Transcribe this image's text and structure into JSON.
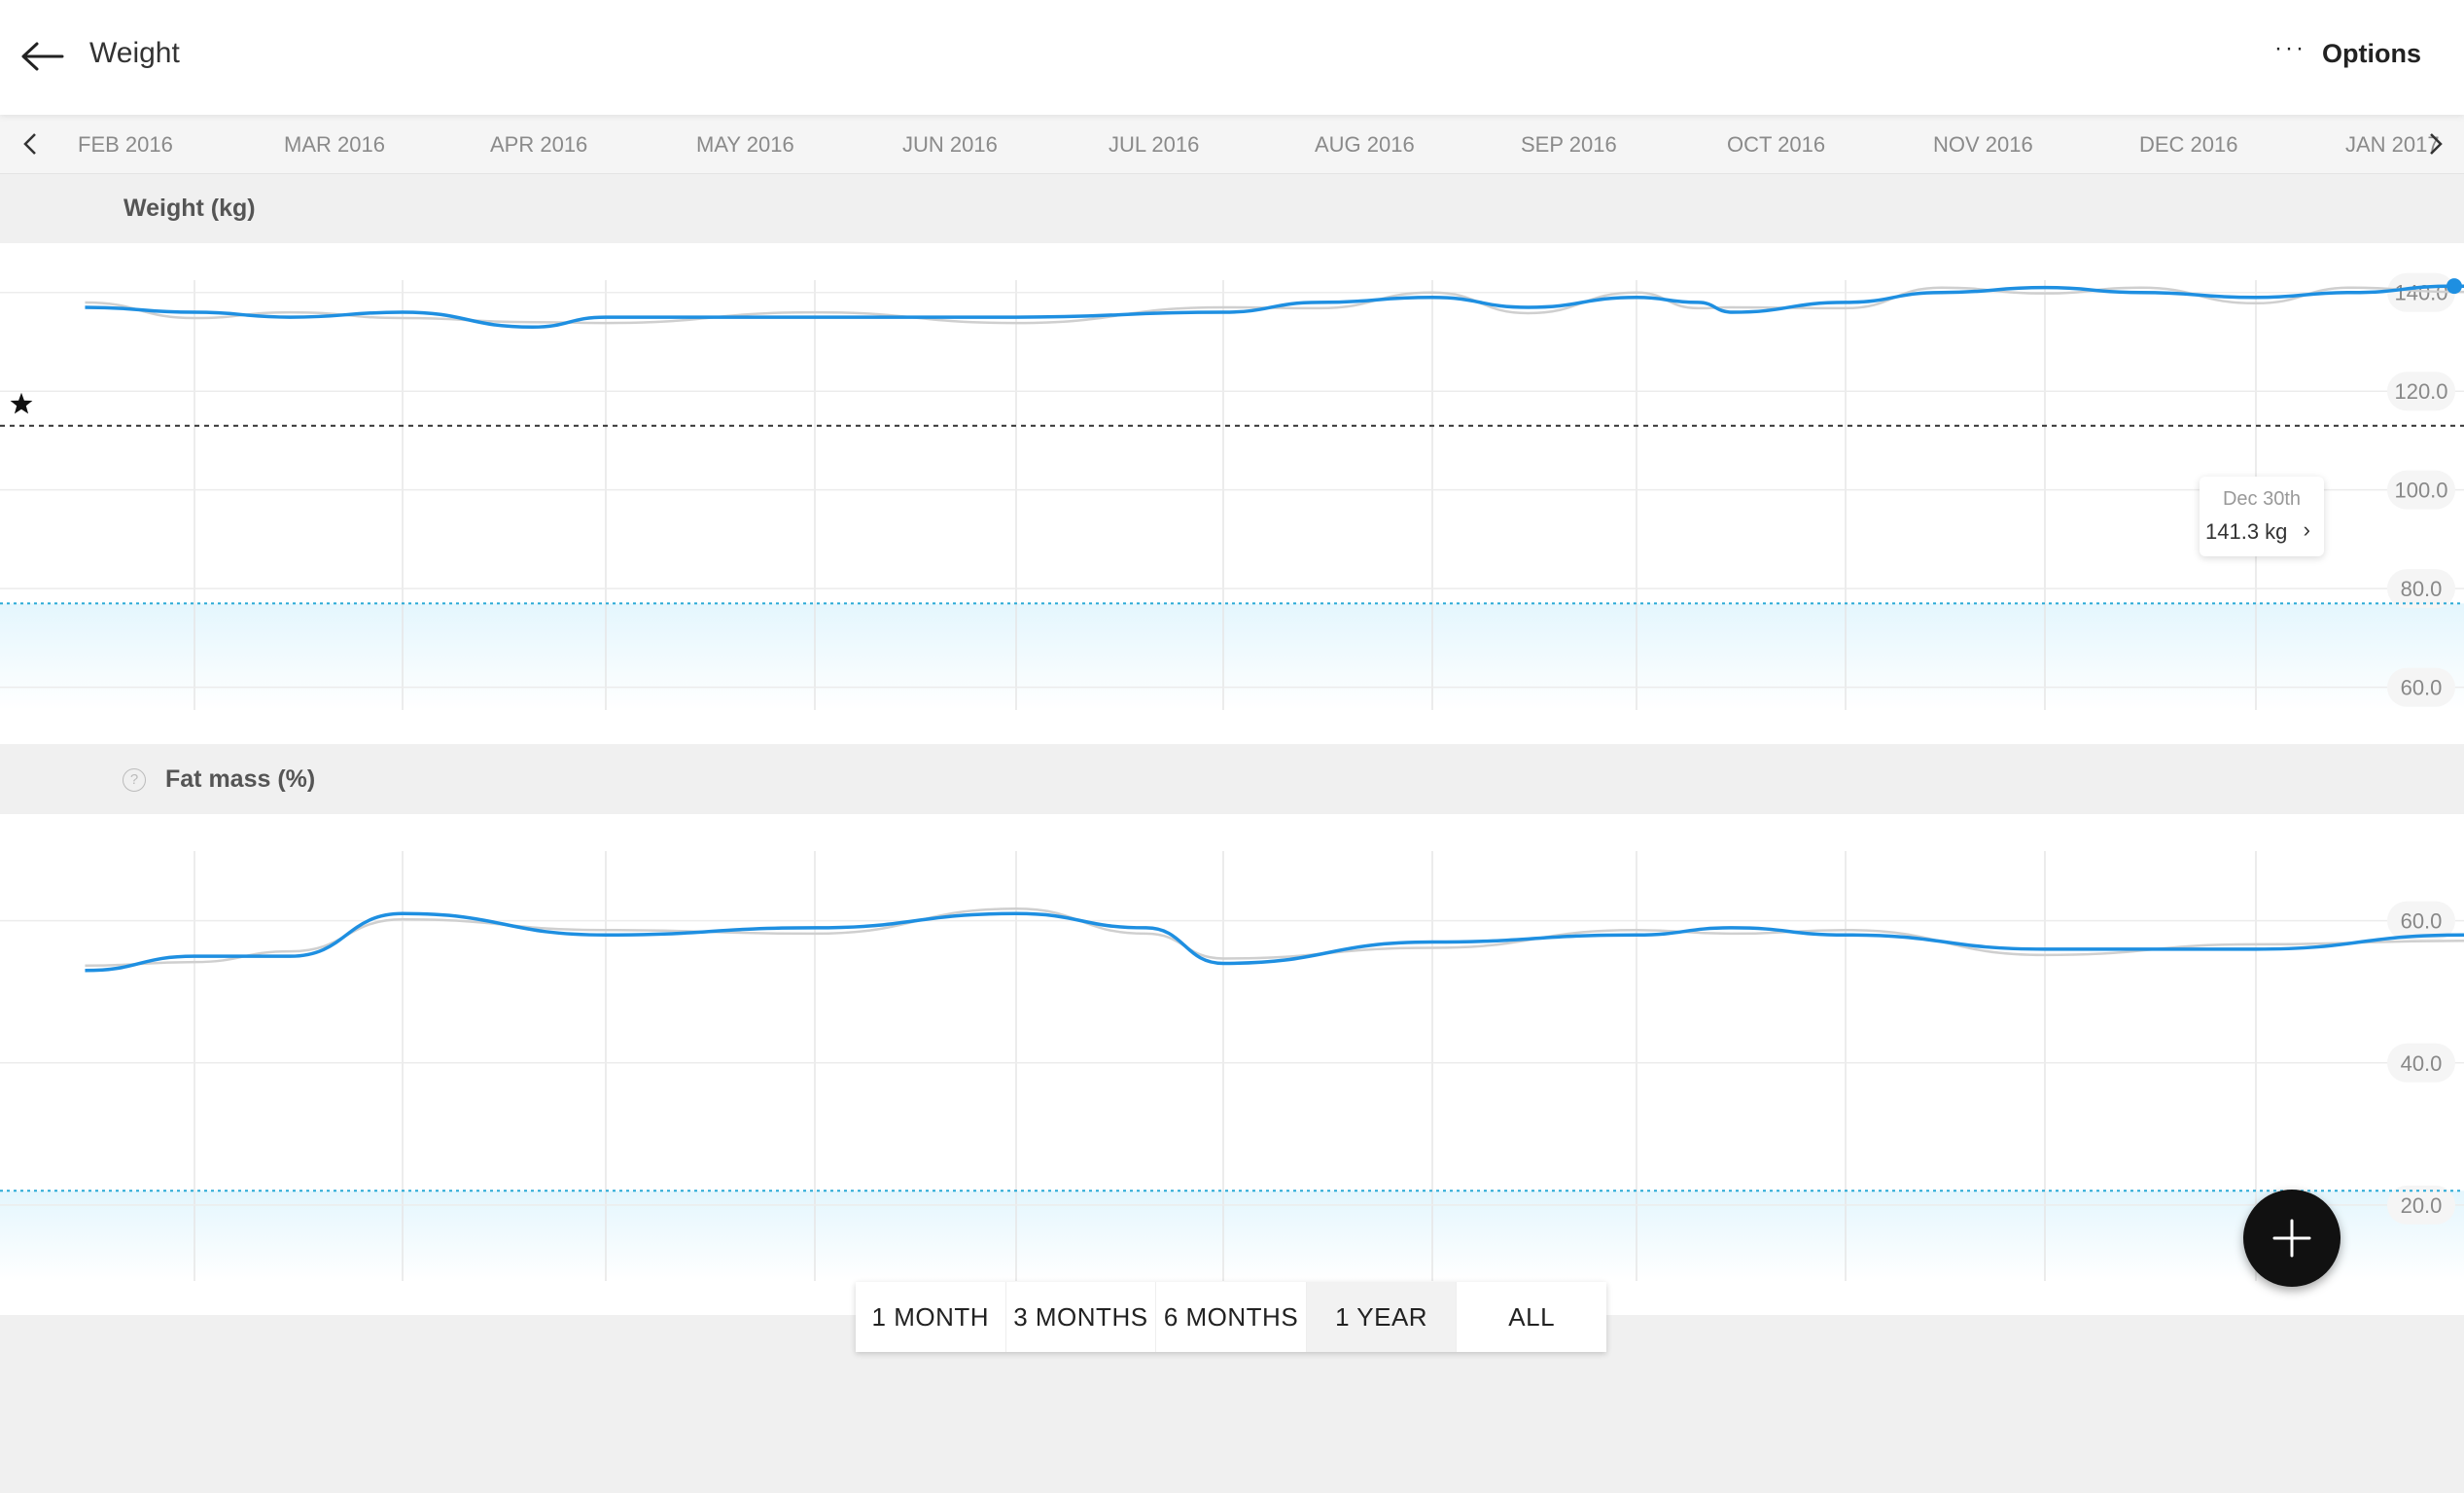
{
  "header": {
    "title": "Weight",
    "options_label": "Options"
  },
  "timeline": {
    "months": [
      "FEB 2016",
      "MAR 2016",
      "APR 2016",
      "MAY 2016",
      "JUN 2016",
      "JUL 2016",
      "AUG 2016",
      "SEP 2016",
      "OCT 2016",
      "NOV 2016",
      "DEC 2016",
      "JAN 2017"
    ]
  },
  "weight": {
    "title": "Weight (kg)",
    "ticks": [
      "140.0",
      "120.0",
      "100.0",
      "80.0",
      "60.0"
    ],
    "tooltip": {
      "date": "Dec 30th",
      "value": "141.3 kg"
    }
  },
  "fat": {
    "title": "Fat mass (%)",
    "ticks": [
      "60.0",
      "40.0",
      "20.0"
    ]
  },
  "ranges": [
    {
      "label": "1 MONTH",
      "active": false
    },
    {
      "label": "3 MONTHS",
      "active": false
    },
    {
      "label": "6 MONTHS",
      "active": false
    },
    {
      "label": "1 YEAR",
      "active": true
    },
    {
      "label": "ALL",
      "active": false
    }
  ],
  "colors": {
    "series": "#1e8fe1",
    "raw": "#cfcfcf",
    "band": "#e4f6fd",
    "band_line": "#29a9d6"
  },
  "chart_data": [
    {
      "type": "line",
      "title": "Weight (kg)",
      "ylim": [
        55,
        150
      ],
      "yticks": [
        140,
        120,
        100,
        80,
        60
      ],
      "x": [
        "2016-01-15",
        "2016-02-01",
        "2016-02-15",
        "2016-03-01",
        "2016-03-20",
        "2016-04-01",
        "2016-05-01",
        "2016-06-01",
        "2016-07-01",
        "2016-07-15",
        "2016-08-01",
        "2016-08-15",
        "2016-09-01",
        "2016-09-10",
        "2016-09-15",
        "2016-10-01",
        "2016-10-15",
        "2016-11-01",
        "2016-11-15",
        "2016-12-01",
        "2016-12-15",
        "2016-12-30",
        "2017-01-15"
      ],
      "series": [
        {
          "values": [
            137,
            136,
            135,
            136,
            133,
            135,
            135,
            135,
            136,
            138,
            139,
            137,
            139,
            138,
            136,
            138,
            140,
            141,
            140,
            139,
            140,
            141.3,
            140
          ]
        }
      ],
      "target_line": 113,
      "normal_band_upper": 77,
      "annotations": [
        {
          "x": "2016-12-30",
          "label": "Dec 30th",
          "value": "141.3 kg"
        }
      ]
    },
    {
      "type": "line",
      "title": "Fat mass (%)",
      "ylim": [
        10,
        75
      ],
      "yticks": [
        60,
        40,
        20
      ],
      "x": [
        "2016-01-15",
        "2016-02-01",
        "2016-02-15",
        "2016-03-01",
        "2016-04-01",
        "2016-05-01",
        "2016-06-01",
        "2016-06-20",
        "2016-07-01",
        "2016-08-01",
        "2016-09-01",
        "2016-09-15",
        "2016-10-01",
        "2016-11-01",
        "2016-12-01",
        "2017-01-01",
        "2017-01-15"
      ],
      "series": [
        {
          "values": [
            53,
            55,
            55,
            61,
            58,
            59,
            61,
            59,
            54,
            57,
            58,
            59,
            58,
            56,
            56,
            58,
            60
          ]
        }
      ],
      "normal_band_upper": 22
    }
  ]
}
